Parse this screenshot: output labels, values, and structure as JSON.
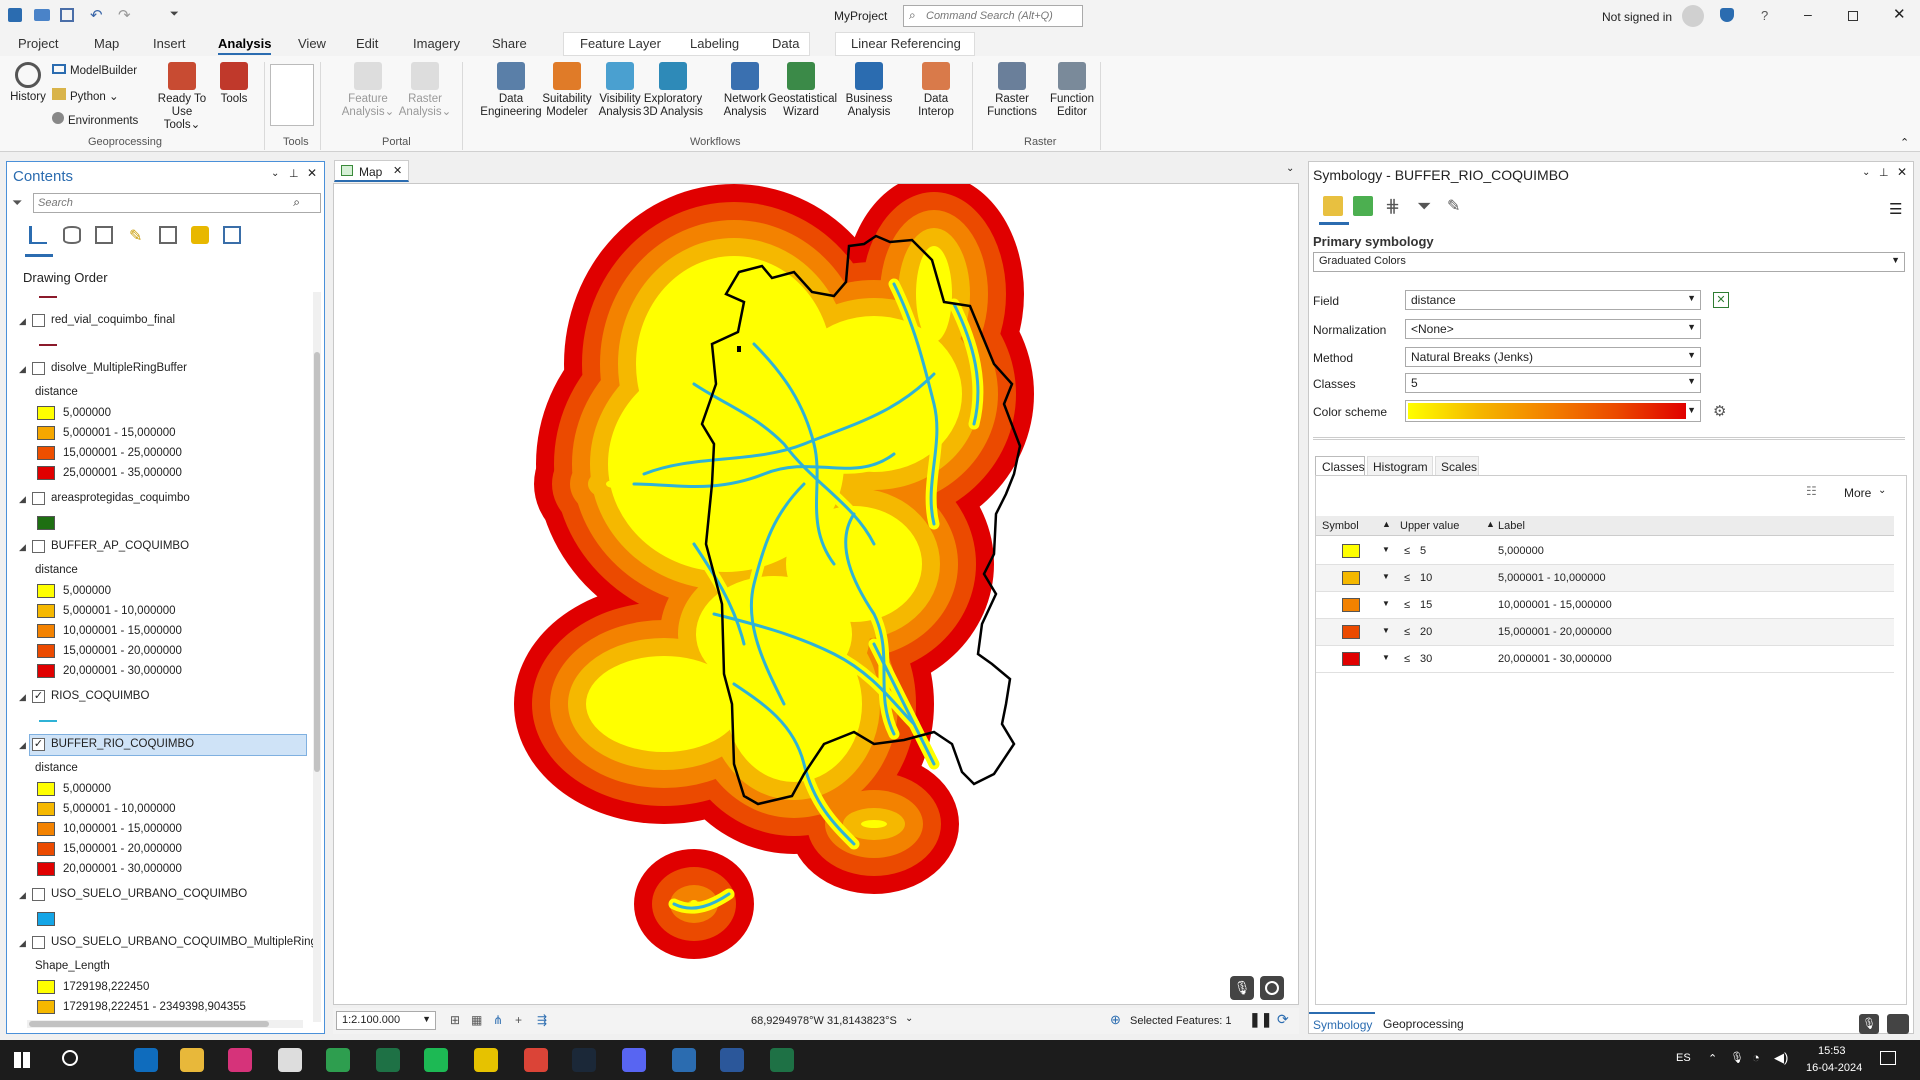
{
  "window": {
    "project": "MyProject",
    "search_placeholder": "Command Search (Alt+Q)",
    "user": "Not signed in"
  },
  "tabs": [
    "Project",
    "Map",
    "Insert",
    "Analysis",
    "View",
    "Edit",
    "Imagery",
    "Share",
    "Feature Layer",
    "Labeling",
    "Data",
    "Linear Referencing"
  ],
  "ribbon": {
    "geoprocessing": {
      "history": "History",
      "modelbuilder": "ModelBuilder",
      "python": "Python",
      "environments": "Environments",
      "ready": "Ready To",
      "ready2": "Use Tools",
      "tools": "Tools",
      "label": "Geoprocessing"
    },
    "tools_label": "Tools",
    "portal": {
      "feature": "Feature",
      "feature2": "Analysis",
      "raster": "Raster",
      "raster2": "Analysis",
      "label": "Portal"
    },
    "workflows": {
      "items": [
        [
          "Data",
          "Engineering"
        ],
        [
          "Suitability",
          "Modeler"
        ],
        [
          "Visibility",
          "Analysis"
        ],
        [
          "Exploratory",
          "3D Analysis"
        ],
        [
          "Network",
          "Analysis"
        ],
        [
          "Geostatistical",
          "Wizard"
        ],
        [
          "Business",
          "Analysis"
        ],
        [
          "Data",
          "Interop"
        ]
      ],
      "label": "Workflows"
    },
    "raster": {
      "items": [
        [
          "Raster",
          "Functions"
        ],
        [
          "Function",
          "Editor"
        ]
      ],
      "label": "Raster"
    }
  },
  "contents": {
    "title": "Contents",
    "search_placeholder": "Search",
    "drawing_order": "Drawing Order",
    "layers": {
      "red_vial": "red_vial_coquimbo_final",
      "disolve": "disolve_MultipleRingBuffer",
      "areas": "areasprotegidas_coquimbo",
      "buffer_ap": "BUFFER_AP_COQUIMBO",
      "rios": "RIOS_COQUIMBO",
      "buffer_rio": "BUFFER_RIO_COQUIMBO",
      "uso": "USO_SUELO_URBANO_COQUIMBO",
      "uso_mrb": "USO_SUELO_URBANO_COQUIMBO_MultipleRing"
    },
    "field_distance": "distance",
    "field_shape": "Shape_Length",
    "disolve_classes": [
      "5,000000",
      "5,000001 - 15,000000",
      "15,000001 - 25,000000",
      "25,000001 - 35,000000"
    ],
    "buffer_classes": [
      "5,000000",
      "5,000001 - 10,000000",
      "10,000001 - 15,000000",
      "15,000001 - 20,000000",
      "20,000001 - 30,000000"
    ],
    "uso_classes": [
      "1729198,222450",
      "1729198,222451 - 2349398,904355"
    ]
  },
  "map": {
    "tab": "Map",
    "scale": "1:2.100.000",
    "coords": "68,9294978°W 31,8143823°S",
    "selected": "Selected Features: 1"
  },
  "symbology": {
    "title": "Symbology - BUFFER_RIO_COQUIMBO",
    "primary": "Primary symbology",
    "renderer": "Graduated Colors",
    "field_label": "Field",
    "field_value": "distance",
    "norm_label": "Normalization",
    "norm_value": "<None>",
    "method_label": "Method",
    "method_value": "Natural Breaks (Jenks)",
    "classes_label": "Classes",
    "classes_value": "5",
    "scheme_label": "Color scheme",
    "subtabs": [
      "Classes",
      "Histogram",
      "Scales"
    ],
    "more": "More",
    "cols": [
      "Symbol",
      "Upper value",
      "Label"
    ],
    "rows": [
      [
        "≤",
        "5",
        "5,000000"
      ],
      [
        "≤",
        "10",
        "5,000001 - 10,000000"
      ],
      [
        "≤",
        "15",
        "10,000001 - 15,000000"
      ],
      [
        "≤",
        "20",
        "15,000001 - 20,000000"
      ],
      [
        "≤",
        "30",
        "20,000001 - 30,000000"
      ]
    ],
    "bottom_tabs": [
      "Symbology",
      "Geoprocessing"
    ]
  },
  "colors": {
    "c1": "#ffff00",
    "c2": "#f5b800",
    "c3": "#f38200",
    "c4": "#eb4a00",
    "c5": "#e00000",
    "disolve": [
      "#ffff00",
      "#f5a700",
      "#ee4f00",
      "#e00000"
    ],
    "area": "#1e6f12",
    "urban": "#14a5e6",
    "river": "#2fb2d6",
    "line": "#8b1a2b"
  },
  "taskbar": {
    "lang": "ES",
    "time": "15:53",
    "date": "16-04-2024"
  }
}
